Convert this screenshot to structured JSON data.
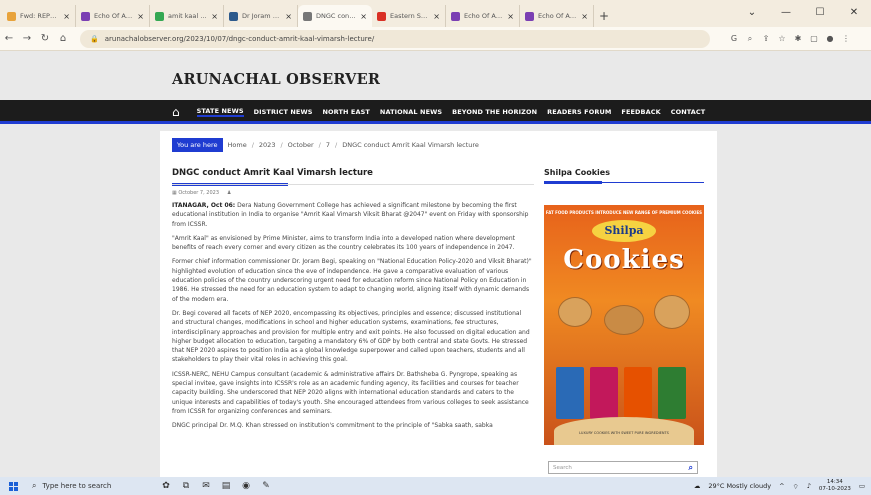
{
  "browser": {
    "tabs": [
      {
        "title": "Fwd: REPORT OF",
        "color": "#e8a33b"
      },
      {
        "title": "Echo Of Arunac",
        "color": "#7b3fb3"
      },
      {
        "title": "amit kaal DNGC",
        "color": "#34a853"
      },
      {
        "title": "Dr Joram Begi d",
        "color": "#2d5a8c"
      },
      {
        "title": "DNGC conduct",
        "color": "#777777"
      },
      {
        "title": "Eastern Sentinel",
        "color": "#d93025"
      },
      {
        "title": "Echo Of Arunach",
        "color": "#7b3fb3"
      },
      {
        "title": "Echo Of Arunach",
        "color": "#7b3fb3"
      }
    ],
    "active_tab_index": 4,
    "url": "arunachalobserver.org/2023/10/07/dngc-conduct-amrit-kaal-vimarsh-lecture/",
    "window_controls": [
      "⌄",
      "—",
      "☐",
      "✕"
    ]
  },
  "site": {
    "title": "ARUNACHAL OBSERVER",
    "nav": [
      "STATE NEWS",
      "DISTRICT NEWS",
      "NORTH EAST",
      "NATIONAL NEWS",
      "BEYOND THE HORIZON",
      "READERS FORUM",
      "FEEDBACK",
      "CONTACT"
    ],
    "active_nav": "STATE NEWS"
  },
  "breadcrumb": {
    "label": "You are here",
    "items": [
      "Home",
      "2023",
      "October",
      "7",
      "DNGC conduct Amrit Kaal Vimarsh lecture"
    ]
  },
  "article": {
    "title": "DNGC conduct Amrit Kaal Vimarsh lecture",
    "date": "October 7, 2023",
    "lead_dateline": "ITANAGAR, Oct 06:",
    "paragraphs": [
      " Dera Natung Government College has achieved a significant milestone by becoming the first educational institution in India to organise \"Amrit Kaal Vimarsh Viksit Bharat @2047\" event on Friday with sponsorship from ICSSR.",
      "\"Amrit Kaal\" as envisioned by Prime Minister, aims to transform India into a developed nation where development benefits of reach every corner and every citizen as the country celebrates its 100 years of independence in 2047.",
      "Former chief information commissioner Dr. Joram Begi, speaking on \"National Education Policy-2020 and Viksit Bharat)\" highlighted evolution of education since the eve of independence. He gave a comparative evaluation of various education policies of the country underscoring urgent need for education reform since National Policy on Education in 1986. He stressed the need for an education system to adapt to changing world, aligning itself with dynamic demands of the modern era.",
      "Dr. Begi covered all facets of NEP 2020, encompassing its objectives, principles and essence; discussed institutional and structural changes, modifications in school and higher education systems, examinations, fee structures, interdisciplinary approaches and provision for multiple entry and exit points. He also focussed on digital education and higher budget allocation to education, targeting a mandatory 6% of GDP by both central and state Govts. He stressed that NEP 2020 aspires to position India as a global knowledge superpower and called upon teachers, students and all stakeholders to play their vital roles in achieving this goal.",
      "ICSSR-NERC, NEHU Campus consultant (academic & administrative affairs Dr. Bathsheba G. Pyngrope, speaking as special invitee, gave insights into ICSSR's role as an academic funding agency, its facilities and courses for teacher capacity building. She underscored that NEP 2020 aligns with international education standards and caters to the unique interests and capabilities of today's youth. She encouraged attendees from various colleges to seek assistance from ICSSR for organizing conferences and seminars.",
      "DNGC principal Dr. M.Q. Khan stressed on institution's commitment to the principle of \"Sabka saath, sabka"
    ]
  },
  "sidebar": {
    "title": "Shilpa Cookies",
    "ad": {
      "top_text": "FAT FOOD PRODUCTS INTRODUCE NEW RANGE OF PREMIUM COOKIES",
      "brand": "Shilpa",
      "product": "Cookies",
      "bottom_text": "LUXURY COOKIES WITH SWEET PURE INGREDIENTS"
    },
    "search_placeholder": "Search"
  },
  "taskbar": {
    "search_placeholder": "Type here to search",
    "weather": "29°C  Mostly cloudy",
    "time": "14:34",
    "date": "07-10-2023"
  }
}
